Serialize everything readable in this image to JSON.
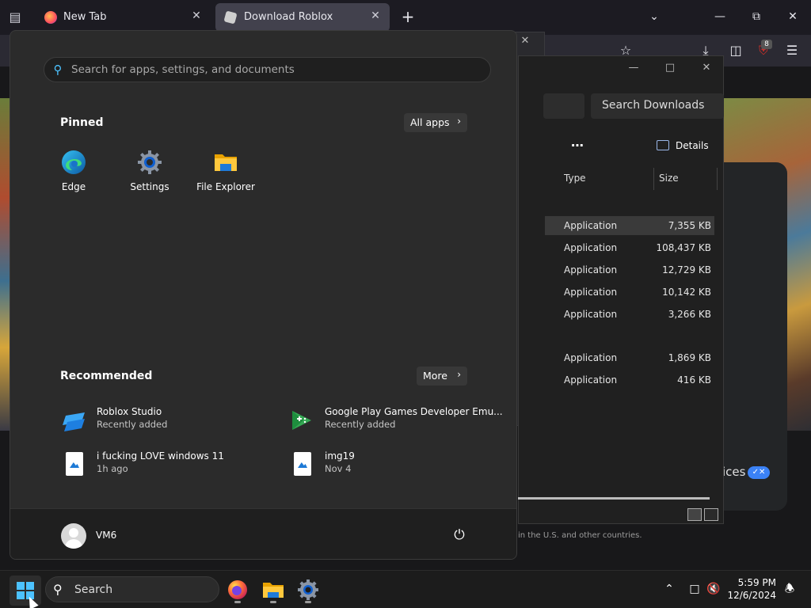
{
  "browser": {
    "tabs": [
      {
        "label": "New Tab"
      },
      {
        "label": "Download Roblox"
      }
    ],
    "icons": [
      "tab-list-icon",
      "close-icon",
      "plus-icon",
      "chevron-down-icon",
      "minimize-icon",
      "restore-icon",
      "close-icon",
      "star-icon",
      "download-icon",
      "extensions-icon",
      "ublock-icon",
      "menu-icon"
    ],
    "ublock_badge": "8"
  },
  "background_page": {
    "services_text": "ices",
    "footer_text": "in the U.S. and other countries."
  },
  "downloads": {
    "search_placeholder": "Search Downloads",
    "details_label": "Details",
    "columns": [
      "Type",
      "Size"
    ],
    "rows": [
      {
        "type": "Application",
        "size": "7,355 KB",
        "selected": true
      },
      {
        "type": "Application",
        "size": "108,437 KB"
      },
      {
        "type": "Application",
        "size": "12,729 KB"
      },
      {
        "type": "Application",
        "size": "10,142 KB"
      },
      {
        "type": "Application",
        "size": "3,266 KB"
      },
      {
        "type": "Application",
        "size": "1,869 KB"
      },
      {
        "type": "Application",
        "size": "416 KB"
      }
    ]
  },
  "start_menu": {
    "search_placeholder": "Search for apps, settings, and documents",
    "pinned_title": "Pinned",
    "all_apps_label": "All apps",
    "pinned": [
      {
        "label": "Edge",
        "icon": "edge-icon"
      },
      {
        "label": "Settings",
        "icon": "settings-gear-icon"
      },
      {
        "label": "File Explorer",
        "icon": "folder-icon"
      }
    ],
    "recommended_title": "Recommended",
    "more_label": "More",
    "recommended": [
      {
        "name": "Roblox Studio",
        "sub": "Recently added",
        "icon": "roblox-studio-icon"
      },
      {
        "name": "Google Play Games Developer Emu...",
        "sub": "Recently added",
        "icon": "google-play-games-icon"
      },
      {
        "name": "i fucking LOVE windows 11",
        "sub": "1h ago",
        "icon": "image-file-icon"
      },
      {
        "name": "img19",
        "sub": "Nov 4",
        "icon": "image-file-icon"
      }
    ],
    "user_name": "VM6"
  },
  "taskbar": {
    "search_label": "Search",
    "time": "5:59 PM",
    "date": "12/6/2024"
  },
  "colors": {
    "accent": "#4cc2ff",
    "start_bg": "#2b2b2b",
    "taskbar_bg": "#1c1c1c"
  }
}
